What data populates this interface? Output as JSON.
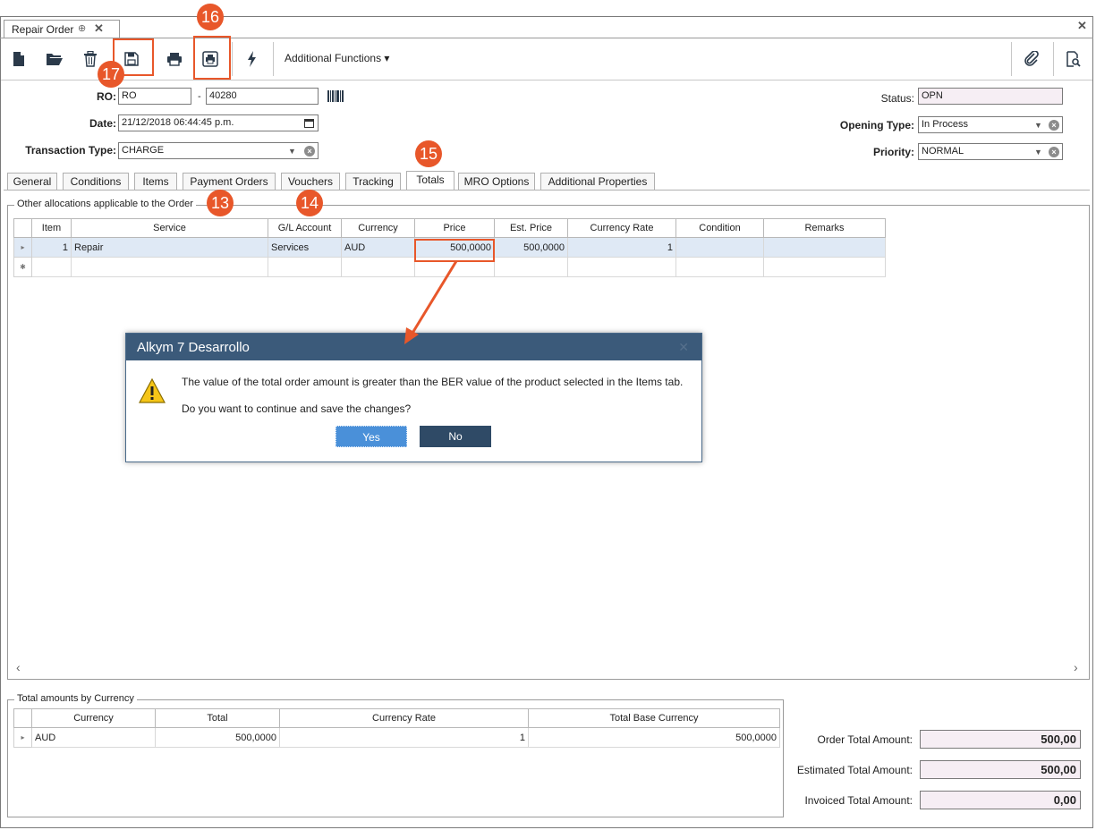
{
  "window": {
    "doc_tab_title": "Repair Order",
    "pin_glyph": "⊕",
    "close_glyph": "✕"
  },
  "toolbar": {
    "additional_functions": "Additional Functions ▾",
    "icons": [
      "new-document-icon",
      "open-folder-icon",
      "delete-icon",
      "save-icon",
      "print-icon",
      "print-preview-icon",
      "lightning-icon",
      "attachment-icon",
      "document-search-icon"
    ]
  },
  "header": {
    "ro_label": "RO:",
    "ro_prefix": "RO",
    "ro_dash": "-",
    "ro_number": "40280",
    "date_label": "Date:",
    "date_value": "21/12/2018 06:44:45 p.m.",
    "transaction_type_label": "Transaction Type:",
    "transaction_type_value": "CHARGE",
    "status_label": "Status:",
    "status_value": "OPN",
    "opening_type_label": "Opening Type:",
    "opening_type_value": "In Process",
    "priority_label": "Priority:",
    "priority_value": "NORMAL"
  },
  "tabs": [
    {
      "label": "General"
    },
    {
      "label": "Conditions"
    },
    {
      "label": "Items"
    },
    {
      "label": "Payment Orders"
    },
    {
      "label": "Vouchers"
    },
    {
      "label": "Tracking"
    },
    {
      "label": "Totals"
    },
    {
      "label": "MRO Options"
    },
    {
      "label": "Additional Properties"
    }
  ],
  "active_tab": "Totals",
  "allocations": {
    "group_title": "Other allocations applicable to the Order",
    "columns": [
      "Item",
      "Service",
      "G/L Account",
      "Currency",
      "Price",
      "Est. Price",
      "Currency Rate",
      "Condition",
      "Remarks"
    ],
    "rows": [
      {
        "item": "1",
        "service": "Repair",
        "gl_account": "Services",
        "currency": "AUD",
        "price": "500,0000",
        "est_price": "500,0000",
        "currency_rate": "1",
        "condition": "",
        "remarks": ""
      }
    ],
    "row_marker": "▸",
    "new_row_marker": "✱"
  },
  "dialog": {
    "title": "Alkym 7 Desarrollo",
    "message_line1": "The value of the total order amount is greater than the BER value of the product selected in the Items tab.",
    "message_line2": "Do you want to continue and save the changes?",
    "yes_label": "Yes",
    "no_label": "No"
  },
  "currency_totals": {
    "group_title": "Total amounts by Currency",
    "columns": [
      "Currency",
      "Total",
      "Currency Rate",
      "Total Base Currency"
    ],
    "rows": [
      {
        "currency": "AUD",
        "total": "500,0000",
        "currency_rate": "1",
        "total_base": "500,0000"
      }
    ]
  },
  "totals": {
    "order_total_label": "Order Total Amount:",
    "order_total_value": "500,00",
    "estimated_total_label": "Estimated Total Amount:",
    "estimated_total_value": "500,00",
    "invoiced_total_label": "Invoiced Total Amount:",
    "invoiced_total_value": "0,00"
  },
  "annotations": {
    "badge_13": "13",
    "badge_14": "14",
    "badge_15": "15",
    "badge_16": "16",
    "badge_17": "17",
    "accent_color": "#e8572a"
  },
  "colors": {
    "dialog_title_bg": "#3b5a7a",
    "yes_button": "#4a90d9",
    "no_button": "#2f4a66",
    "readonly_field": "#f6eef4"
  }
}
